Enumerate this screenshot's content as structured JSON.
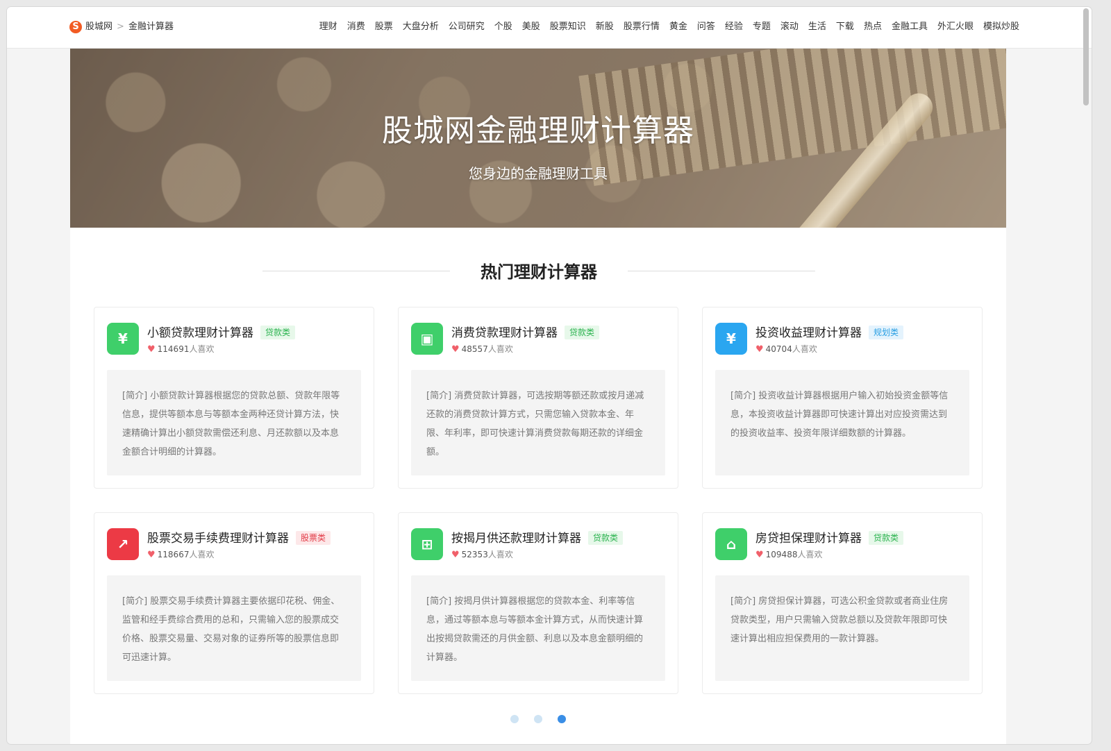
{
  "header": {
    "logo_glyph": "S",
    "site_name": "股城网",
    "separator": ">",
    "current_page": "金融计算器",
    "nav": [
      "理财",
      "消费",
      "股票",
      "大盘分析",
      "公司研究",
      "个股",
      "美股",
      "股票知识",
      "新股",
      "股票行情",
      "黄金",
      "问答",
      "经验",
      "专题",
      "滚动",
      "生活",
      "下载",
      "热点",
      "金融工具",
      "外汇火眼",
      "模拟炒股"
    ]
  },
  "banner": {
    "title": "股城网金融理财计算器",
    "subtitle": "您身边的金融理财工具"
  },
  "section": {
    "title": "热门理财计算器"
  },
  "likes_suffix": "人喜欢",
  "cards": [
    {
      "title": "小额贷款理财计算器",
      "tag": "贷款类",
      "tag_color": "green",
      "likes": "114691",
      "icon": "yen-coin-icon",
      "icon_glyph": "¥",
      "icon_color": "#3fcf6a",
      "desc": "[简介] 小额贷款计算器根据您的贷款总额、贷款年限等信息，提供等额本息与等额本金两种还贷计算方法，快速精确计算出小额贷款需偿还利息、月还款额以及本息金额合计明细的计算器。"
    },
    {
      "title": "消费贷款理财计算器",
      "tag": "贷款类",
      "tag_color": "green",
      "likes": "48557",
      "icon": "shopping-bag-icon",
      "icon_glyph": "▣",
      "icon_color": "#3fcf6a",
      "desc": "[简介] 消费贷款计算器，可选按期等额还款或按月递减还款的消费贷款计算方式，只需您输入贷款本金、年限、年利率，即可快速计算消费贷款每期还款的详细金额。"
    },
    {
      "title": "投资收益理财计算器",
      "tag": "规划类",
      "tag_color": "blue",
      "likes": "40704",
      "icon": "hexagon-yen-icon",
      "icon_glyph": "¥",
      "icon_color": "#2aa6f0",
      "desc": "[简介] 投资收益计算器根据用户输入初始投资金额等信息，本投资收益计算器即可快速计算出对应投资需达到的投资收益率、投资年限详细数额的计算器。"
    },
    {
      "title": "股票交易手续费理财计算器",
      "tag": "股票类",
      "tag_color": "red",
      "likes": "118667",
      "icon": "stock-chart-icon",
      "icon_glyph": "↗",
      "icon_color": "#ec3a45",
      "desc": "[简介] 股票交易手续费计算器主要依据印花税、佣金、监管和经手费综合费用的总和，只需输入您的股票成交价格、股票交易量、交易对象的证券所等的股票信息即可迅速计算。"
    },
    {
      "title": "按揭月供还款理财计算器",
      "tag": "贷款类",
      "tag_color": "green",
      "likes": "52353",
      "icon": "mortgage-icon",
      "icon_glyph": "⊞",
      "icon_color": "#3fcf6a",
      "desc": "[简介] 按揭月供计算器根据您的贷款本金、利率等信息，通过等额本息与等额本金计算方式，从而快速计算出按揭贷款需还的月供金额、利息以及本息金额明细的计算器。"
    },
    {
      "title": "房贷担保理财计算器",
      "tag": "贷款类",
      "tag_color": "green",
      "likes": "109488",
      "icon": "house-loan-icon",
      "icon_glyph": "⌂",
      "icon_color": "#3fcf6a",
      "desc": "[简介] 房贷担保计算器，可选公积金贷款或者商业住房贷款类型，用户只需输入贷款总额以及贷款年限即可快速计算出相应担保费用的一款计算器。"
    }
  ],
  "pagination": {
    "total": 3,
    "active": 3
  }
}
